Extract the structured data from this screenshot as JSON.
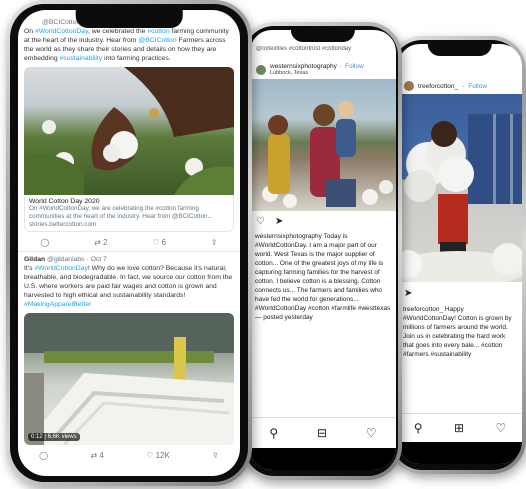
{
  "phone1": {
    "tweet1": {
      "handle": "@BCICotton",
      "line1_pre": "On ",
      "line1_hash1": "#WorldCottonDay",
      "line1_mid": ", we celebrated the ",
      "line1_hash2": "#cotton",
      "line1_post": " farming community at the heart of the industry. Hear from ",
      "line1_mention": "@BCICotton",
      "line2": " Farmers across the world as they share their stories and details on how they are embedding ",
      "line2_hash": "#sustainability",
      "line2_post": " into farming practices.",
      "card_title": "World Cotton Day 2020",
      "card_desc": "On #WorldCottonDay, we are celebrating the #cotton farming communities at the heart of the industry. Hear from @BCICotton...",
      "card_url": "stories.bettercotton.com",
      "retweets": "2",
      "likes": "6"
    },
    "tweet2": {
      "name": "Gildan",
      "handle": "@gildanlabs · Oct 7",
      "text_pre": "It's ",
      "text_hash1": "#WorldCottonDay",
      "text_mid": "! Why do we love cotton? Because it's natural, breathable, and biodegradable. In fact, we source our cotton from the U.S. where workers are paid fair wages and cotton is grown and harvested to high ethical and sustainability standards! ",
      "text_hash2": "#MakingApparelBetter",
      "video_badge": "0:12 | 6.6K views",
      "retweets": "4",
      "likes": "12K"
    }
  },
  "phone2": {
    "top_handle": "@oxtextiles #cottontrust #cottonday",
    "account": "westernsixphotography",
    "follow": "Follow",
    "location": "Lubbock, Texas",
    "caption": "westernsixphotography Today is #WorldCottonDay. I am a major part of our world. West Texas is the major supplier of cotton... One of the greatest joys of my life is capturing farming families for the harvest of cotton. I believe cotton is a blessing. Cotton connects us... The farmers and families who have fed the world for generations... #WorldCottonDay #cotton #farmlife #westtexas — posted yesterday"
  },
  "phone3": {
    "account": "treeforcotton_",
    "follow": "Follow",
    "caption": "treeforcotton_ Happy #WorldCottonDay! Cotton is grown by millions of farmers around the world. Join us in celebrating the hard work that goes into every bale... #cotton #farmers #sustainability"
  },
  "colors": {
    "twitter_blue": "#1da1f2",
    "instagram_blue": "#3897f0",
    "bezel": "#0c0c0c"
  },
  "icons": [
    "reply-icon",
    "retweet-icon",
    "like-icon",
    "share-icon",
    "home-icon",
    "search-icon",
    "add-icon",
    "heart-icon",
    "profile-icon",
    "send-icon"
  ]
}
